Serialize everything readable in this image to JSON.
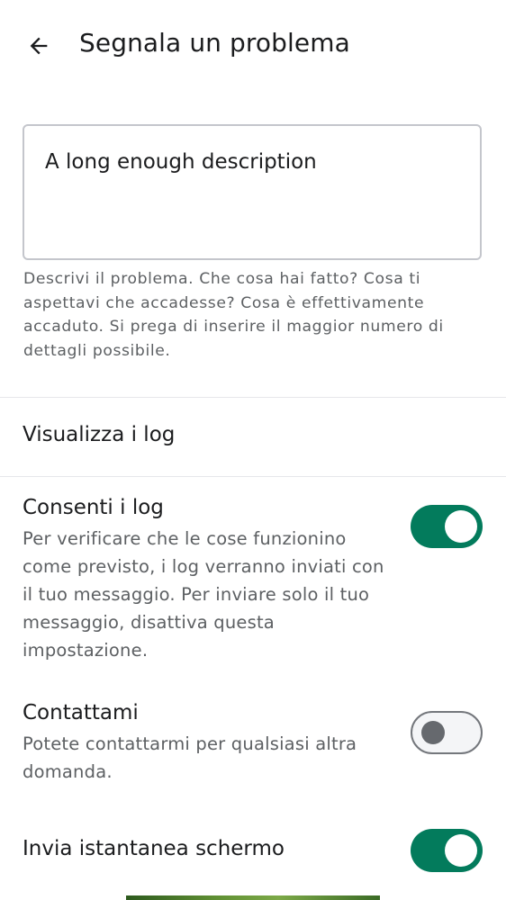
{
  "header": {
    "title": "Segnala un problema",
    "back_icon": "arrow-back-icon"
  },
  "description": {
    "value": "A long enough description",
    "helper": "Descrivi il problema. Che cosa hai fatto? Cosa ti aspettavi che accadesse? Cosa è effettivamente accaduto. Si prega di inserire il maggior numero di dettagli possibile."
  },
  "view_logs": {
    "label": "Visualizza i log"
  },
  "settings": {
    "allow_logs": {
      "title": "Consenti i log",
      "description": "Per verificare che le cose funzionino come previsto, i log verranno inviati con il tuo messaggio. Per inviare solo il tuo messaggio, disattiva questa impostazione.",
      "enabled": true
    },
    "contact_me": {
      "title": "Contattami",
      "description": "Potete contattarmi per qualsiasi altra domanda.",
      "enabled": false
    },
    "send_screenshot": {
      "title": "Invia istantanea schermo",
      "enabled": true
    }
  },
  "colors": {
    "accent": "#037b5c",
    "text_primary": "#1b1c1e",
    "text_secondary": "#5d6063",
    "outline": "#c4c6cc",
    "divider": "#e6e7ea"
  }
}
